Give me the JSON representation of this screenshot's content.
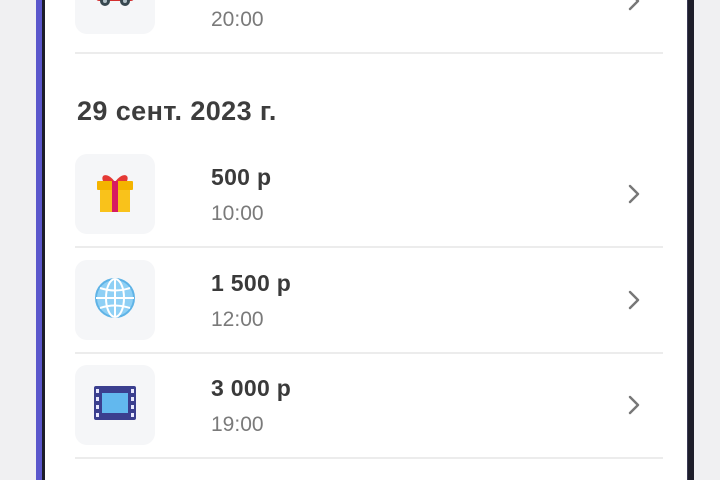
{
  "transactions_top": [
    {
      "amount": "",
      "time": "20:00",
      "icon": "car-icon"
    }
  ],
  "group": {
    "date": "29 сент. 2023 г.",
    "items": [
      {
        "amount": "500 р",
        "time": "10:00",
        "icon": "gift-icon"
      },
      {
        "amount": "1 500 р",
        "time": "12:00",
        "icon": "globe-icon"
      },
      {
        "amount": "3 000 р",
        "time": "19:00",
        "icon": "film-icon"
      }
    ]
  },
  "colors": {
    "bezel_accent": "#5b57cc",
    "text_primary": "#3a3a3a",
    "text_secondary": "#7a7a7a",
    "tile_bg": "#f5f6f8"
  }
}
